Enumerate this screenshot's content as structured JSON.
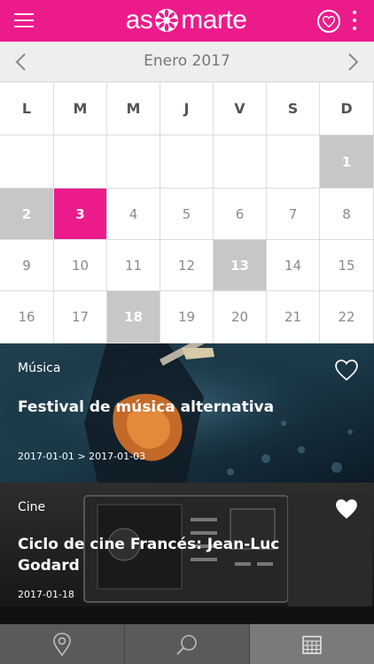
{
  "header": {
    "logo_text_left": "as",
    "logo_text_right": "marte",
    "menu_icon": "hamburger-menu-icon",
    "favorites_icon": "heart-circle-icon",
    "more_icon": "vertical-dots-icon",
    "accent_color": "#ec1b8c"
  },
  "calendar": {
    "month_label": "Enero 2017",
    "prev_icon": "chevron-left-icon",
    "next_icon": "chevron-right-icon",
    "weekdays": [
      "L",
      "M",
      "M",
      "J",
      "V",
      "S",
      "D"
    ],
    "weeks": [
      [
        "",
        "",
        "",
        "",
        "",
        "",
        "1"
      ],
      [
        "2",
        "3",
        "4",
        "5",
        "6",
        "7",
        "8"
      ],
      [
        "9",
        "10",
        "11",
        "12",
        "13",
        "14",
        "15"
      ],
      [
        "16",
        "17",
        "18",
        "19",
        "20",
        "21",
        "22"
      ]
    ],
    "highlighted_days": [
      "1",
      "2",
      "13",
      "18"
    ],
    "today": "3"
  },
  "events": [
    {
      "category": "Música",
      "title": "Festival de música alternativa",
      "date": "2017-01-01 > 2017-01-03",
      "favorited": false
    },
    {
      "category": "Cine",
      "title": "Ciclo de cine Francés: Jean-Luc Godard",
      "date": "2017-01-18",
      "favorited": true
    }
  ],
  "tabs": [
    {
      "icon": "map-pin-icon",
      "active": false
    },
    {
      "icon": "search-icon",
      "active": false
    },
    {
      "icon": "calendar-icon",
      "active": true
    }
  ]
}
